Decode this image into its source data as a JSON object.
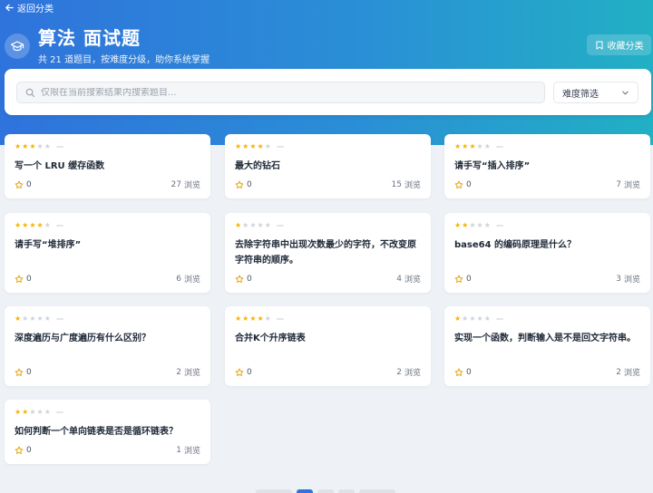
{
  "nav": {
    "back_label": "返回分类"
  },
  "header": {
    "category": "算法",
    "title": "面试题",
    "subtitle": "共 21 道题目，按难度分级，助你系统掌握",
    "collect_label": "收藏分类",
    "icon": "graduation-cap-icon"
  },
  "search": {
    "placeholder": "仅限在当前搜索结果内搜索题目...",
    "value": "",
    "difficulty_selected": "难度筛选"
  },
  "views_unit": "浏览",
  "colors": {
    "accent": "#2f73dc",
    "star": "#f5b400"
  },
  "questions": [
    {
      "title": "写一个 LRU 缓存函数",
      "stars": 3,
      "likes": "0",
      "views": "27"
    },
    {
      "title": "最大的钻石",
      "stars": 4,
      "likes": "0",
      "views": "15"
    },
    {
      "title": "请手写“插入排序”",
      "stars": 3,
      "likes": "0",
      "views": "7"
    },
    {
      "title": "请手写“堆排序”",
      "stars": 4,
      "likes": "0",
      "views": "6"
    },
    {
      "title": "去除字符串中出现次数最少的字符，不改变原字符串的顺序。",
      "stars": 1,
      "likes": "0",
      "views": "4"
    },
    {
      "title": "base64 的编码原理是什么？",
      "stars": 2,
      "likes": "0",
      "views": "3"
    },
    {
      "title": "深度遍历与广度遍历有什么区别？",
      "stars": 1,
      "likes": "0",
      "views": "2"
    },
    {
      "title": "合并K个升序链表",
      "stars": 4,
      "likes": "0",
      "views": "2"
    },
    {
      "title": "实现一个函数，判断输入是不是回文字符串。",
      "stars": 1,
      "likes": "0",
      "views": "2"
    },
    {
      "title": "如何判断一个单向链表是否是循环链表？",
      "stars": 2,
      "likes": "0",
      "views": "1"
    }
  ]
}
